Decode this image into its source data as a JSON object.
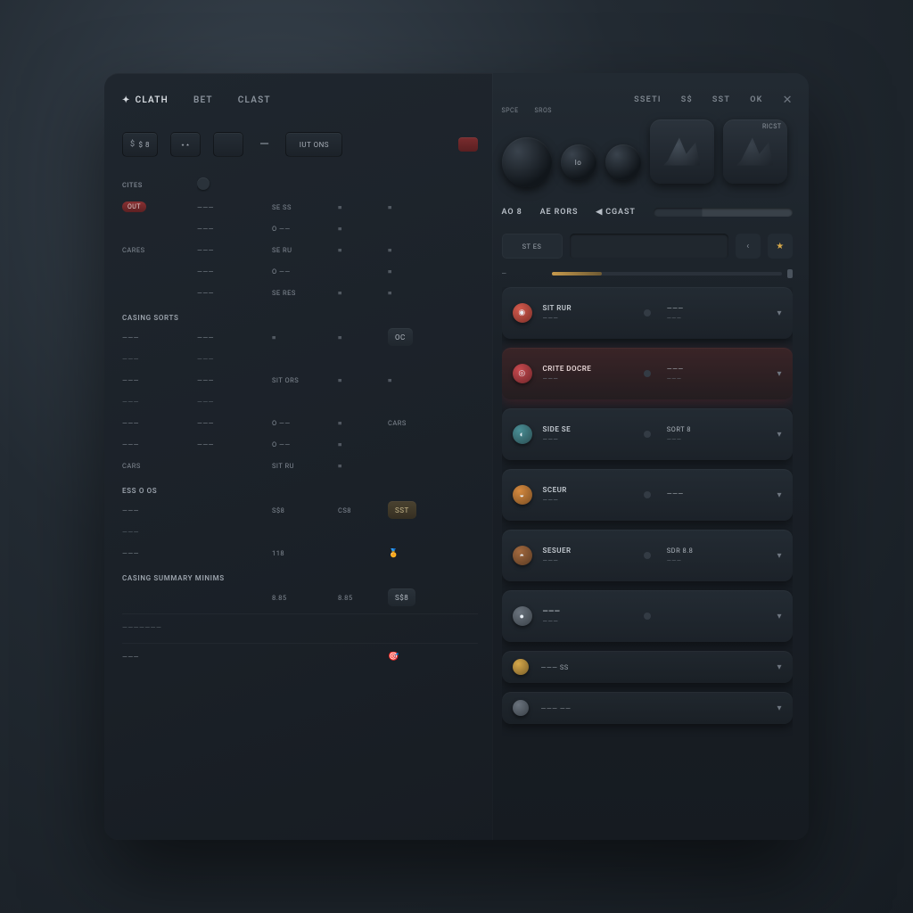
{
  "header": {
    "tabs": [
      {
        "label": "CLATH",
        "active": true,
        "icon": "✦"
      },
      {
        "label": "BET",
        "active": false
      },
      {
        "label": "CLAST",
        "active": false
      }
    ],
    "right_tabs": [
      {
        "label": "SSETI"
      },
      {
        "label": "S$"
      },
      {
        "label": "SST"
      },
      {
        "label": "OK"
      }
    ]
  },
  "toolbar": {
    "b1": "$ 8",
    "b2": "⋆⋆",
    "b3": "",
    "dash": "—",
    "b4": "IUT ONS"
  },
  "list": {
    "header": [
      "CITES",
      "",
      "",
      "",
      ""
    ],
    "radio_row": {
      "label": "",
      "icon": true
    },
    "rows": [
      {
        "c0": "",
        "pill": "OUT",
        "c1": "———",
        "c2": "SE SS",
        "c3": "≡",
        "c4": "≡"
      },
      {
        "c0": "",
        "c1": "———",
        "c2": "O ——",
        "c3": "≡",
        "c4": ""
      },
      {
        "c0": "CARES",
        "c1": "———",
        "c2": "SE RU",
        "c3": "≡",
        "c4": "≡"
      },
      {
        "c0": "",
        "c1": "———",
        "c2": "O ——",
        "c3": "",
        "c4": "≡"
      },
      {
        "c0": "",
        "c1": "———",
        "c2": "SE RES",
        "c3": "≡",
        "c4": "≡"
      }
    ],
    "section2": "CASING SORTS",
    "rows2": [
      {
        "c0": "———",
        "c1": "———",
        "c2": "≡",
        "c3": "≡",
        "c4": "OC"
      },
      {
        "c0": "———",
        "c1": "———",
        "c2": "",
        "c3": "",
        "c4": ""
      },
      {
        "c0": "———",
        "c1": "———",
        "c2": "SIT ORS",
        "c3": "≡",
        "c4": "≡"
      },
      {
        "c0": "———",
        "c1": "———",
        "c2": "",
        "c3": "",
        "c4": ""
      },
      {
        "c0": "———",
        "c1": "———",
        "c2": "O ——",
        "c3": "≡",
        "c4": "CARS"
      },
      {
        "c0": "———",
        "c1": "———",
        "c2": "O ——",
        "c3": "≡",
        "c4": ""
      },
      {
        "c0": "CARS",
        "c1": "",
        "c2": "SIT RU",
        "c3": "≡",
        "c4": ""
      }
    ],
    "section3": "ESS O OS",
    "rows3": [
      {
        "c0": "———",
        "c1": "",
        "c2": "S$8",
        "c3": "CS8",
        "c4_chip": "SST"
      },
      {
        "c0": "———",
        "c1": "",
        "c2": "",
        "c3": "",
        "c4": ""
      },
      {
        "c0": "———",
        "c1": "",
        "c2": "118",
        "c3": "",
        "c4_icon": "🏅"
      }
    ],
    "section4": "CASING SUMMARY MINIMS",
    "rows4": [
      {
        "c0": "",
        "c1": "",
        "c2": "8.85",
        "c3": "8.85",
        "c4_chip": "S$8"
      }
    ],
    "footer_rows": [
      {
        "c0": "———————"
      },
      {
        "c0": "———",
        "c4_icon": "🎯"
      }
    ]
  },
  "right": {
    "knob_labels": [
      "SPCE",
      "SROS",
      ""
    ],
    "thumb_label": "RICST",
    "labels": {
      "a": "AO  8",
      "b": "AE RORS",
      "c": "CGAST"
    },
    "filter_chip": "ST  ES",
    "track_label": "—",
    "cards": [
      {
        "icon": "ci-red",
        "title": "SIT RUR",
        "sub": "———",
        "r_title": "———",
        "r_sub": "———"
      },
      {
        "icon": "ci-crim",
        "title": "CRITE DOCRE",
        "sub": "———",
        "r_title": "———",
        "r_sub": "———",
        "alert": true
      },
      {
        "icon": "ci-teal",
        "title": "SIDE SE",
        "sub": "———",
        "r_title": "SORT  8",
        "r_sub": "———"
      },
      {
        "icon": "ci-orng",
        "title": "SCEUR",
        "sub": "———",
        "r_title": "———",
        "r_sub": ""
      },
      {
        "icon": "ci-brn",
        "title": "SESUER",
        "sub": "———",
        "r_title": "SDR  8.8",
        "r_sub": "———"
      },
      {
        "icon": "ci-gry",
        "title": "———",
        "sub": "———",
        "r_title": "",
        "r_sub": ""
      }
    ],
    "slim_cards": [
      {
        "icon": "ci-gold",
        "title": "———  SS"
      },
      {
        "icon": "ci-gry",
        "title": "———  ——"
      }
    ]
  }
}
